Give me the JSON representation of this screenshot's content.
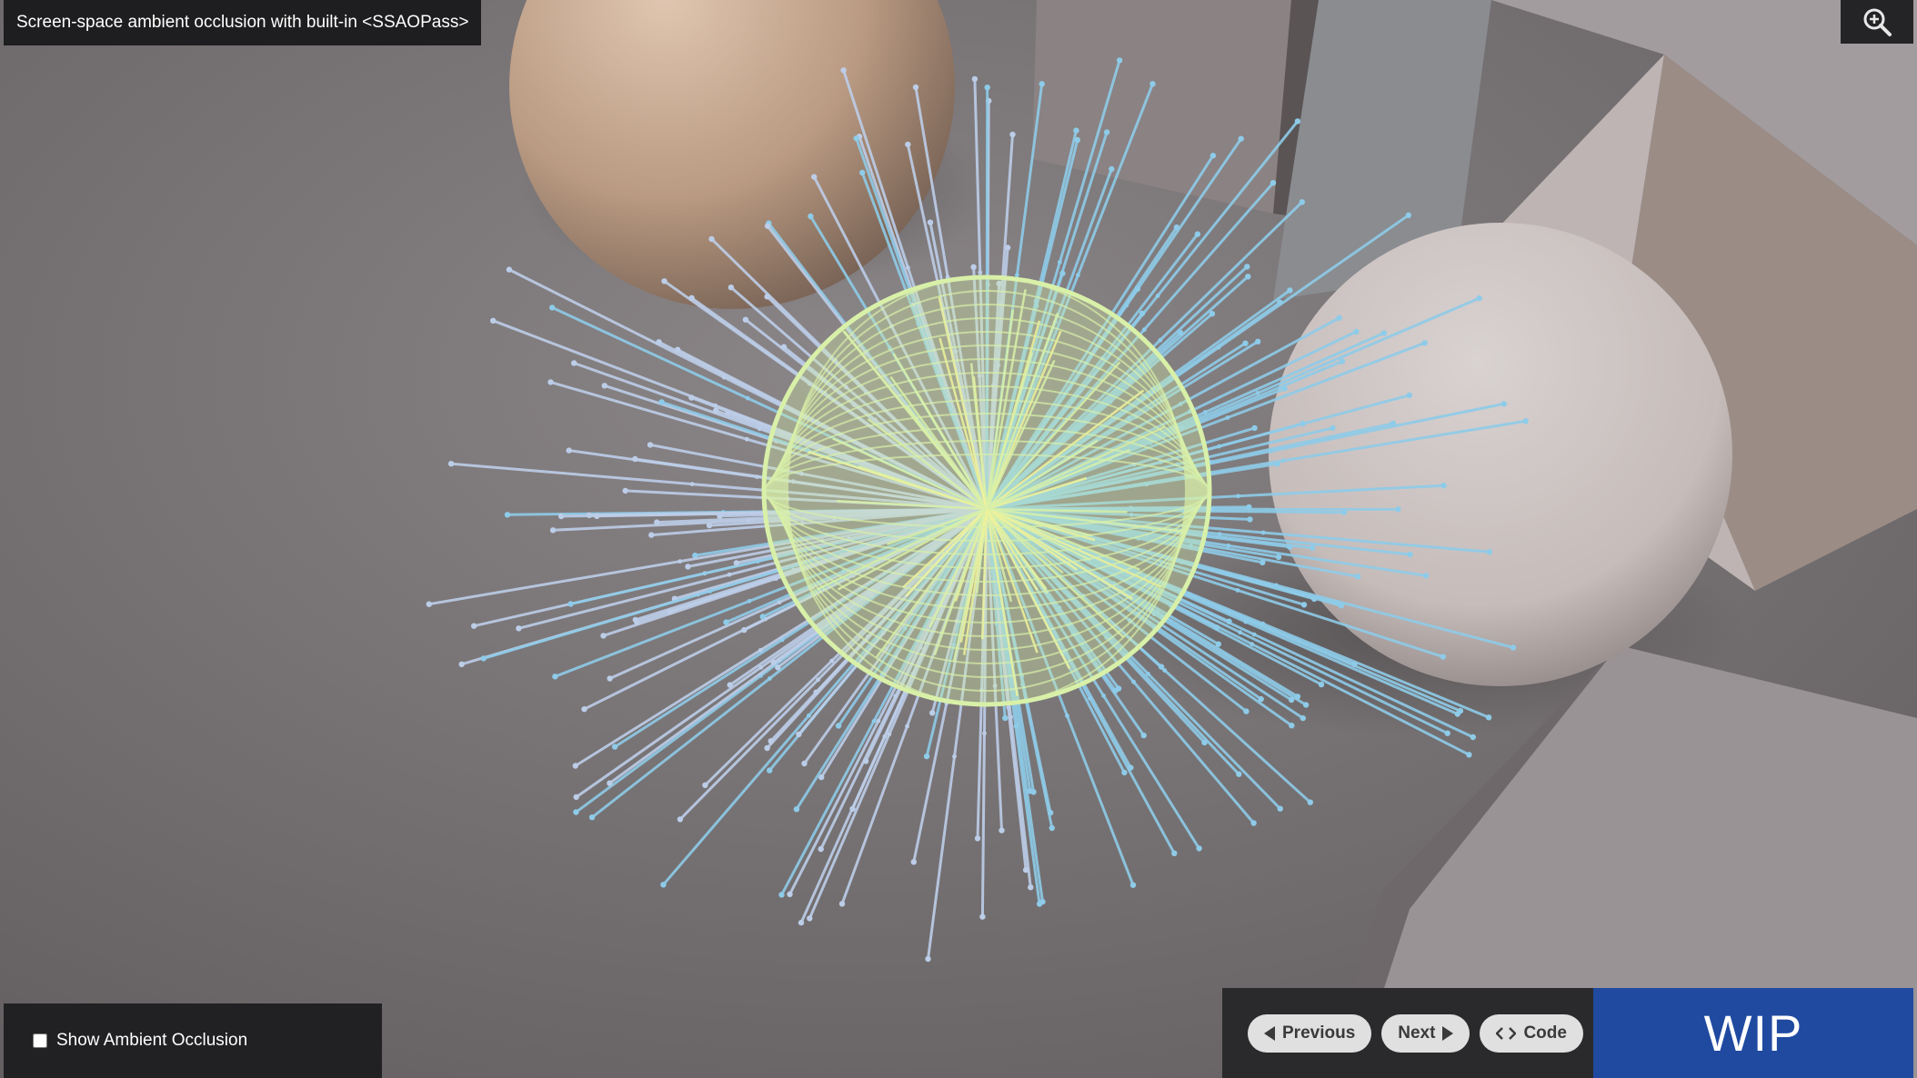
{
  "header": {
    "title": "Screen-space ambient occlusion with built-in <SSAOPass>",
    "zoom_icon": "zoom-in-icon"
  },
  "options": {
    "ambient_occlusion_label": "Show Ambient Occlusion",
    "ambient_occlusion_checked": false
  },
  "navigation": {
    "previous_label": "Previous",
    "previous_icon": "triangle-left-icon",
    "next_label": "Next",
    "next_icon": "triangle-right-icon",
    "code_label": "Code",
    "code_icon": "code-brackets-icon"
  },
  "badge": {
    "label": "WIP",
    "color": "#1f4aa0"
  },
  "colors": {
    "kernel_hemisphere": "#d8f0a8",
    "kernel_hemisphere_highlight": "#eef29a",
    "sample_rays_light": "#bccde8",
    "sample_rays_blue": "#8ecbe8",
    "ground": "#6f6b6c",
    "sphere_tan": "#c2a58e",
    "sphere_white": "#cfc8c6"
  }
}
